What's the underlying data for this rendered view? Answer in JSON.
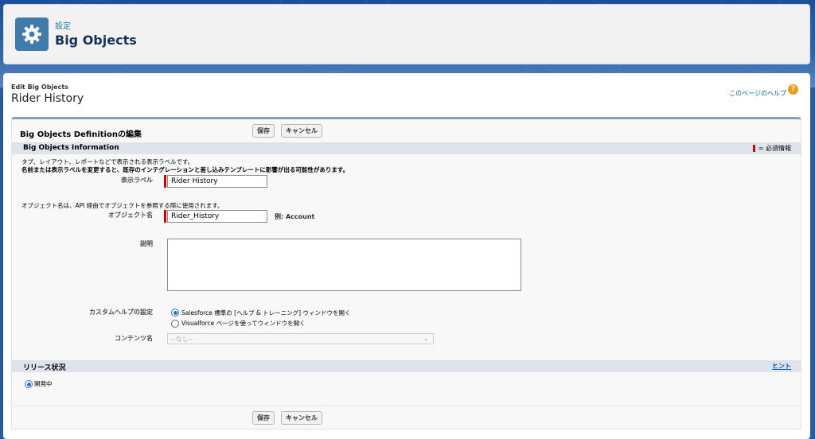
{
  "header": {
    "breadcrumb": "設定",
    "title": "Big Objects"
  },
  "page": {
    "subtitle": "Edit Big Objects",
    "title": "Rider History",
    "help_link": "このページのヘルプ",
    "help_icon_glyph": "?"
  },
  "section": {
    "title": "Big Objects Definitionの編集",
    "save_label": "保存",
    "cancel_label": "キャンセル"
  },
  "info_section": {
    "title": "Big Objects Information",
    "required_legend": "= 必須情報",
    "label_note_1": "タブ、レイアウト、レポートなどで表示される表示ラベルです。",
    "label_note_2": "名前または表示ラベルを変更すると、既存のインテグレーションと差し込みテンプレートに影響が出る可能性があります。",
    "label_field": {
      "label": "表示ラベル",
      "value": "Rider History"
    },
    "name_note": "オブジェクト名は、API 経由でオブジェクトを参照する際に使用されます。",
    "name_field": {
      "label": "オブジェクト名",
      "value": "Rider_History",
      "example": "例:  Account"
    },
    "description_label": "説明",
    "custom_help": {
      "label": "カスタムヘルプの設定",
      "option_1": "Salesforce 標準の [ヘルプ & トレーニング] ウィンドウを開く",
      "option_2": "Visualforce ページを使ってウィンドウを開く"
    },
    "content_name": {
      "label": "コンテンツ名",
      "value": "--なし--"
    }
  },
  "release_section": {
    "title": "リリース状況",
    "hint": "ヒント",
    "option": "開発中"
  }
}
